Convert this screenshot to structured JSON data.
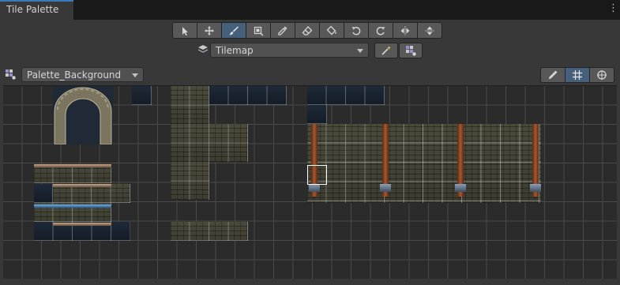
{
  "tab": {
    "title": "Tile Palette",
    "menu_icon": "kebab-menu-icon"
  },
  "toolbar": {
    "tools": [
      {
        "name": "select",
        "icon": "arrow-pointer-icon",
        "active": false
      },
      {
        "name": "move",
        "icon": "move-arrows-icon",
        "active": false
      },
      {
        "name": "paint",
        "icon": "brush-icon",
        "active": true
      },
      {
        "name": "box-fill",
        "icon": "box-fill-icon",
        "active": false
      },
      {
        "name": "picker",
        "icon": "eyedropper-icon",
        "active": false
      },
      {
        "name": "erase",
        "icon": "eraser-icon",
        "active": false
      },
      {
        "name": "fill",
        "icon": "paint-bucket-icon",
        "active": false
      },
      {
        "name": "rotate-ccw",
        "icon": "rotate-left-icon",
        "active": false
      },
      {
        "name": "rotate-cw",
        "icon": "rotate-right-icon",
        "active": false
      },
      {
        "name": "flip-x",
        "icon": "flip-horizontal-icon",
        "active": false
      },
      {
        "name": "flip-y",
        "icon": "flip-vertical-icon",
        "active": false
      }
    ]
  },
  "target": {
    "selected": "Tilemap",
    "icon": "tilemap-layers-icon"
  },
  "palette": {
    "selected": "Palette_Background",
    "icon": "palette-grid-icon"
  },
  "view_buttons": [
    {
      "name": "edit",
      "icon": "pencil-icon",
      "active": false
    },
    {
      "name": "grid",
      "icon": "grid-icon",
      "active": true
    },
    {
      "name": "gizmos",
      "icon": "gizmo-icon",
      "active": false
    }
  ],
  "colors": {
    "accent": "#3a79bb",
    "active_button": "#46607c",
    "panel": "#383838",
    "grid_bg": "#2b2b2b"
  }
}
